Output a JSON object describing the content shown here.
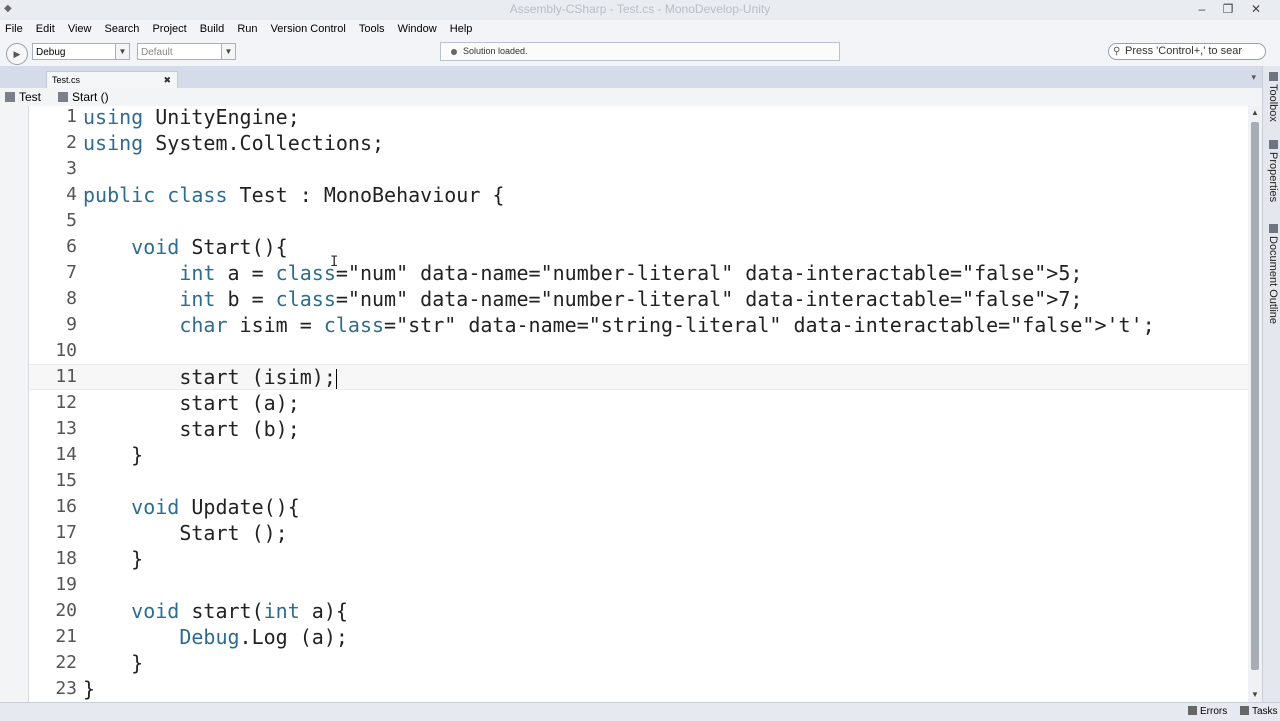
{
  "window": {
    "title": "Assembly-CSharp - Test.cs - MonoDevelop-Unity"
  },
  "menu": [
    "File",
    "Edit",
    "View",
    "Search",
    "Project",
    "Build",
    "Run",
    "Version Control",
    "Tools",
    "Window",
    "Help"
  ],
  "toolbar": {
    "config_value": "Debug",
    "platform_value": "Default",
    "status_text": "Solution loaded.",
    "search_placeholder": "Press 'Control+,' to sear"
  },
  "tabs": [
    {
      "label": "Test.cs"
    }
  ],
  "breadcrumb": {
    "class": "Test",
    "method": "Start ()"
  },
  "editor": {
    "current_line": 11,
    "lines": [
      {
        "n": "1",
        "text": "using UnityEngine;"
      },
      {
        "n": "2",
        "text": "using System.Collections;"
      },
      {
        "n": "3",
        "text": ""
      },
      {
        "n": "4",
        "text": "public class Test : MonoBehaviour {"
      },
      {
        "n": "5",
        "text": ""
      },
      {
        "n": "6",
        "text": "    void Start(){"
      },
      {
        "n": "7",
        "text": "        int a = 5;"
      },
      {
        "n": "8",
        "text": "        int b = 7;"
      },
      {
        "n": "9",
        "text": "        char isim = 't';"
      },
      {
        "n": "10",
        "text": ""
      },
      {
        "n": "11",
        "text": "        start (isim);"
      },
      {
        "n": "12",
        "text": "        start (a);"
      },
      {
        "n": "13",
        "text": "        start (b);"
      },
      {
        "n": "14",
        "text": "    }"
      },
      {
        "n": "15",
        "text": ""
      },
      {
        "n": "16",
        "text": "    void Update(){"
      },
      {
        "n": "17",
        "text": "        Start ();"
      },
      {
        "n": "18",
        "text": "    }"
      },
      {
        "n": "19",
        "text": ""
      },
      {
        "n": "20",
        "text": "    void start(int a){"
      },
      {
        "n": "21",
        "text": "        Debug.Log (a);"
      },
      {
        "n": "22",
        "text": "    }"
      },
      {
        "n": "23",
        "text": "}"
      }
    ]
  },
  "dock": [
    "Toolbox",
    "Properties",
    "Document Outline"
  ],
  "statusbar": {
    "errors": "Errors",
    "tasks": "Tasks"
  },
  "colors": {
    "keyword": "#2f6c8f",
    "literal": "#a04c1a",
    "background": "#d6dbe9"
  }
}
